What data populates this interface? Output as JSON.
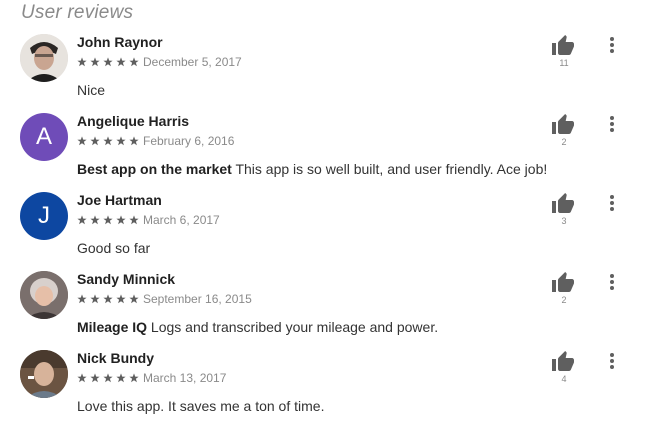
{
  "section": {
    "title": "User reviews"
  },
  "colors": {
    "avatar_purple": "#6f4cb8",
    "avatar_blue": "#0d47a1",
    "star": "#5f5f5f",
    "thumb": "#5f5f5f"
  },
  "reviews": [
    {
      "author": "John Raynor",
      "avatar": "photo",
      "rating": 5,
      "date": "December 5, 2017",
      "title": "",
      "text": "Nice",
      "helpful_count": "11"
    },
    {
      "author": "Angelique Harris",
      "avatar": "letter",
      "avatar_letter": "A",
      "rating": 5,
      "date": "February 6, 2016",
      "title": "Best app on the market",
      "text": "This app is so well built, and user friendly. Ace job!",
      "helpful_count": "2"
    },
    {
      "author": "Joe Hartman",
      "avatar": "letter",
      "avatar_letter": "J",
      "rating": 5,
      "date": "March 6, 2017",
      "title": "",
      "text": "Good so far",
      "helpful_count": "3"
    },
    {
      "author": "Sandy Minnick",
      "avatar": "photo",
      "rating": 5,
      "date": "September 16, 2015",
      "title": "Mileage IQ",
      "text": "Logs and transcribed your mileage and power.",
      "helpful_count": "2"
    },
    {
      "author": "Nick Bundy",
      "avatar": "photo",
      "rating": 5,
      "date": "March 13, 2017",
      "title": "",
      "text": "Love this app. It saves me a ton of time.",
      "helpful_count": "4"
    }
  ],
  "icons": {
    "star": "star-icon",
    "thumb": "thumbs-up-icon",
    "more": "more-vert-icon"
  }
}
